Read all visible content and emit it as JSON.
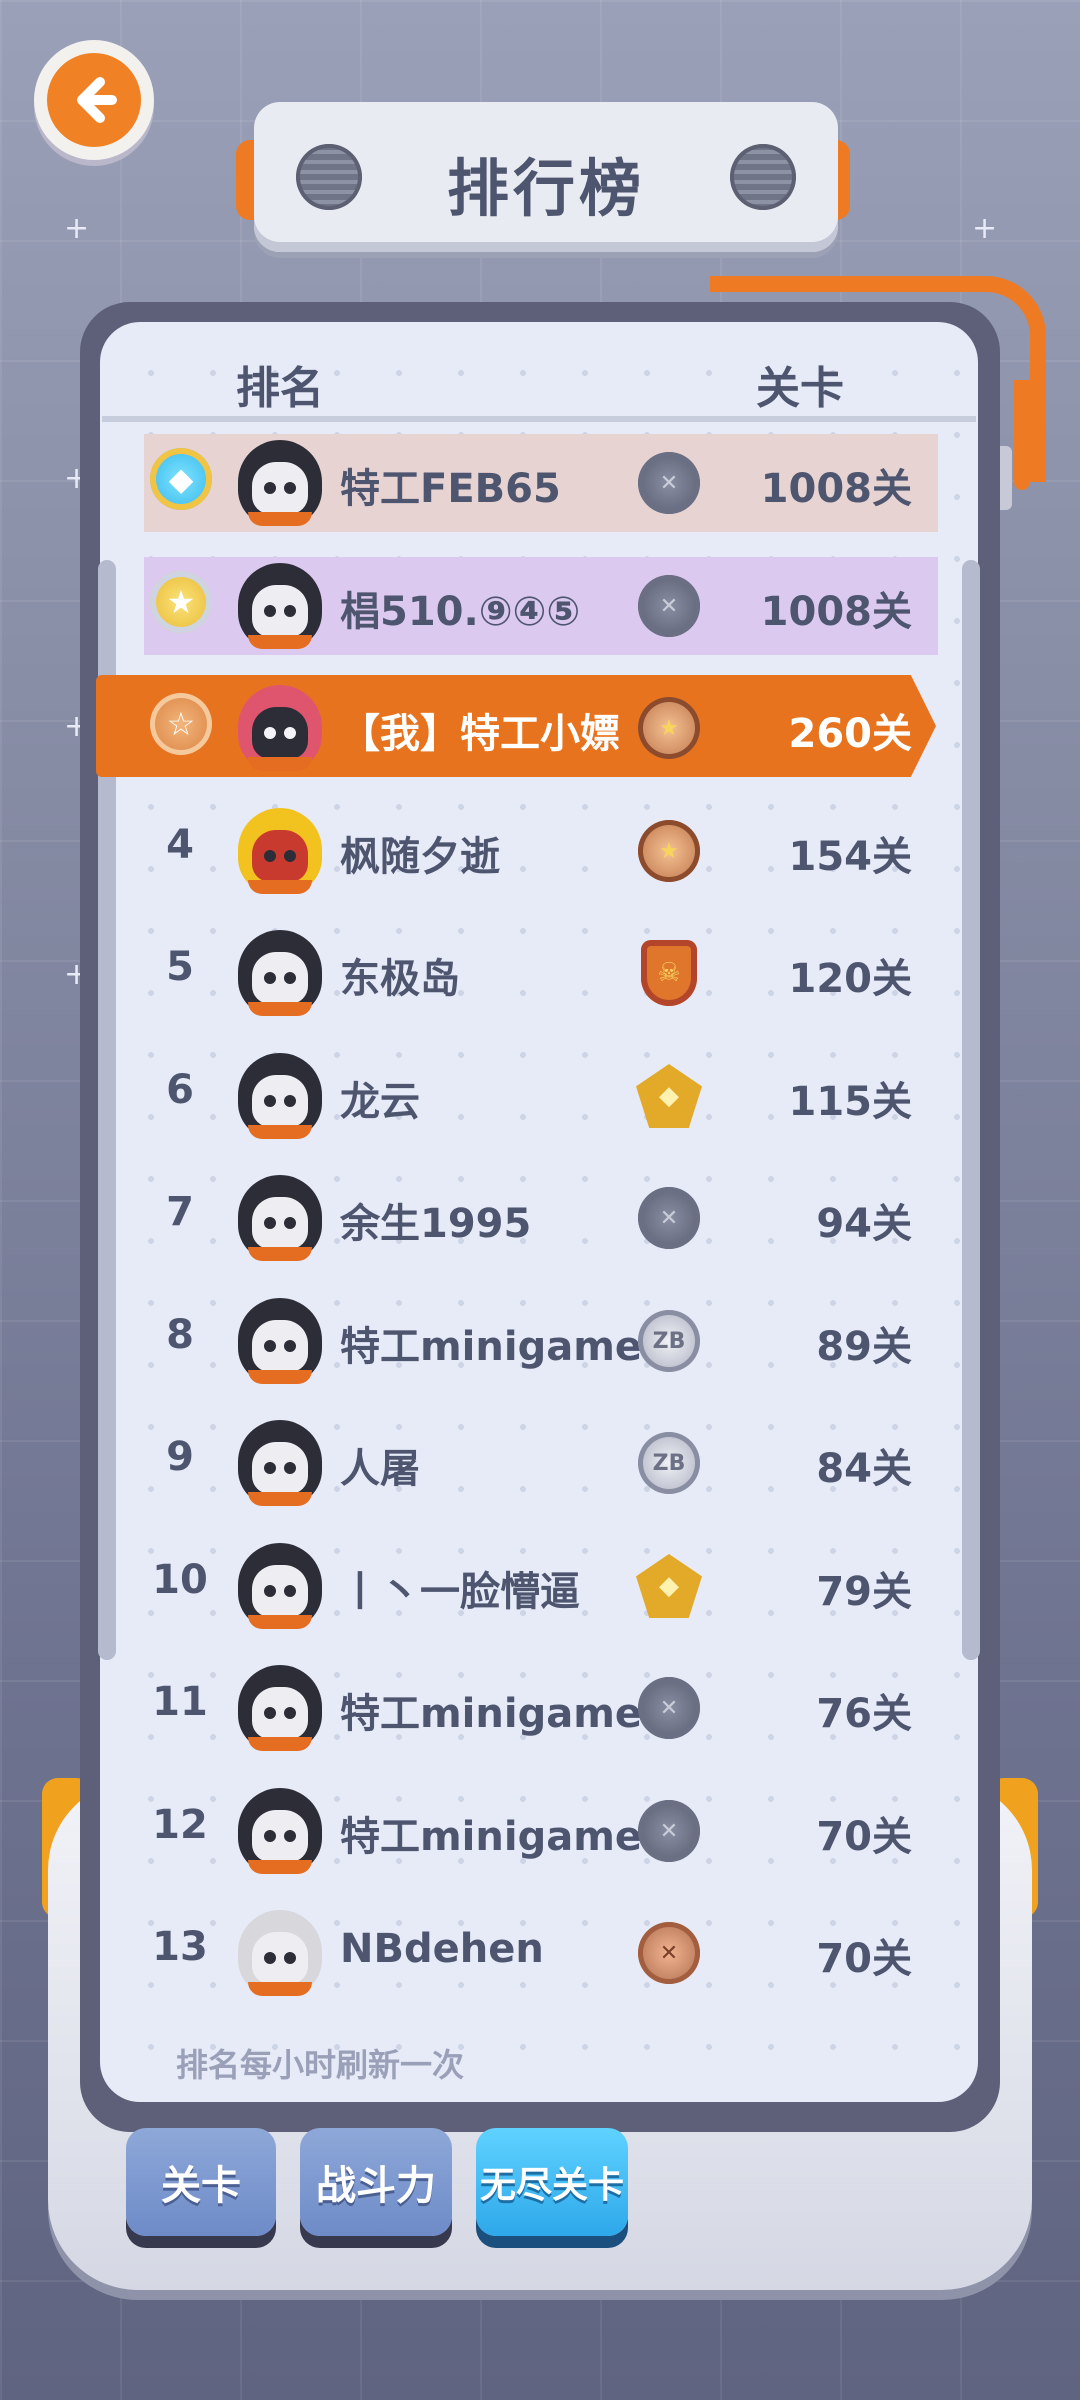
{
  "title": "排行榜",
  "header": {
    "rank_label": "排名",
    "level_label": "关卡"
  },
  "rows": [
    {
      "rank": "",
      "medal": "diamond-medal-icon",
      "name": "特工FEB65",
      "badge": "gray-x-badge",
      "score": "1008关",
      "highlight": "#e8d3d3"
    },
    {
      "rank": "",
      "medal": "gold-medal-icon",
      "name": "椙510.⑨④⑤",
      "badge": "gray-x-badge",
      "score": "1008关",
      "highlight": "#dcc9ef"
    },
    {
      "rank": "",
      "medal": "bronze-medal-icon",
      "name": "【我】特工小嫖",
      "badge": "bronze-star-badge",
      "score": "260关",
      "highlight": "#e8731f"
    },
    {
      "rank": "4",
      "medal": "",
      "name": "枫随夕逝",
      "badge": "bronze-star-badge",
      "score": "154关"
    },
    {
      "rank": "5",
      "medal": "",
      "name": "东极岛",
      "badge": "orange-shield-badge",
      "score": "120关"
    },
    {
      "rank": "6",
      "medal": "",
      "name": "龙云",
      "badge": "gold-wing-badge",
      "score": "115关"
    },
    {
      "rank": "7",
      "medal": "",
      "name": "余生1995",
      "badge": "gray-x-badge",
      "score": "94关"
    },
    {
      "rank": "8",
      "medal": "",
      "name": "特工minigame",
      "badge": "silver-zb-badge",
      "score": "89关"
    },
    {
      "rank": "9",
      "medal": "",
      "name": "人屠",
      "badge": "silver-zb-badge",
      "score": "84关"
    },
    {
      "rank": "10",
      "medal": "",
      "name": "丨丶一脸懵逼",
      "badge": "gold-wing-badge",
      "score": "79关"
    },
    {
      "rank": "11",
      "medal": "",
      "name": "特工minigame",
      "badge": "gray-x-badge",
      "score": "76关"
    },
    {
      "rank": "12",
      "medal": "",
      "name": "特工minigame",
      "badge": "gray-x-badge",
      "score": "70关"
    },
    {
      "rank": "13",
      "medal": "",
      "name": "NBdehen",
      "badge": "bronze-x-badge",
      "score": "70关"
    }
  ],
  "badge_text": {
    "zb": "ZB"
  },
  "footnote": "排名每小时刷新一次",
  "tabs": [
    {
      "label": "关卡",
      "active": false
    },
    {
      "label": "战斗力",
      "active": false
    },
    {
      "label": "无尽关卡",
      "active": true
    }
  ],
  "colors": {
    "accent": "#ee7a24",
    "text": "#4e556f",
    "active_tab": "#2ea8ea",
    "inactive_tab": "#7a96cf"
  }
}
